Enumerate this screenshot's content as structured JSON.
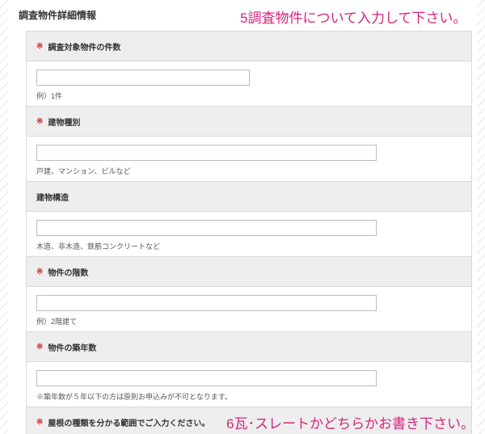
{
  "section_title": "調査物件詳細情報",
  "annotations": {
    "top": "5調査物件について入力して下さい。",
    "bottom": "6瓦･スレートかどちらかお書き下さい。"
  },
  "required_mark": "※",
  "fields": [
    {
      "label": "調査対象物件の件数",
      "required": true,
      "value": "",
      "hint": "例）1件"
    },
    {
      "label": "建物種別",
      "required": true,
      "value": "",
      "hint": "戸建、マンション、ビルなど"
    },
    {
      "label": "建物構造",
      "required": false,
      "value": "",
      "hint": "木造、非木造、鉄筋コンクリートなど"
    },
    {
      "label": "物件の階数",
      "required": true,
      "value": "",
      "hint": "例）2階建て"
    },
    {
      "label": "物件の築年数",
      "required": true,
      "value": "",
      "hint": "※築年数が５年以下の方は原則お申込みが不可となります。"
    },
    {
      "label": "屋根の種類を分かる範囲でご入力ください。",
      "required": true
    }
  ]
}
